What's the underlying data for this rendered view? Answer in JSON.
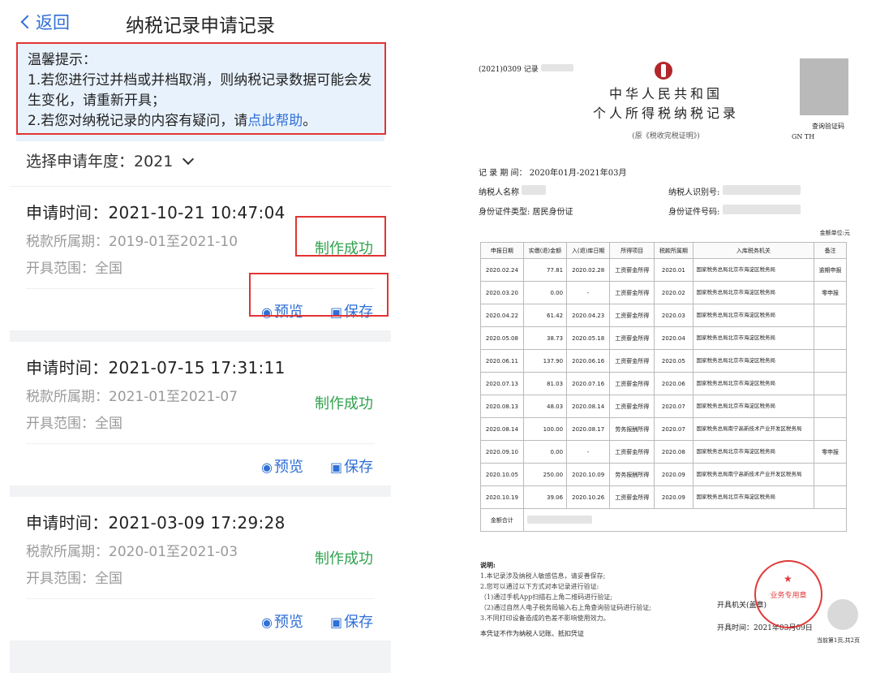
{
  "app": {
    "back_label": "返回",
    "title": "纳税记录申请记录",
    "tips": {
      "heading": "温馨提示：",
      "line1": "1.若您进行过并档或并档取消，则纳税记录数据可能会发生变化，请重新开具；",
      "line2_prefix": "2.若您对纳税记录的内容有疑问，请",
      "line2_link": "点此帮助",
      "line2_suffix": "。"
    },
    "year_label": "选择申请年度：2021",
    "records": [
      {
        "time": "申请时间：2021-10-21 10:47:04",
        "period": "税款所属期：2019-01至2021-10",
        "scope": "开具范围：全国",
        "status": "制作成功",
        "preview": "预览",
        "save": "保存"
      },
      {
        "time": "申请时间：2021-07-15 17:31:11",
        "period": "税款所属期：2021-01至2021-07",
        "scope": "开具范围：全国",
        "status": "制作成功",
        "preview": "预览",
        "save": "保存"
      },
      {
        "time": "申请时间：2021-03-09 17:29:28",
        "period": "税款所属期：2020-01至2021-03",
        "scope": "开具范围：全国",
        "status": "制作成功",
        "preview": "预览",
        "save": "保存"
      }
    ],
    "colors": {
      "accent": "#2f6fd6",
      "success": "#2fa24e",
      "highlight": "#e23434",
      "tip_bg": "#e8f2fd"
    }
  },
  "doc": {
    "number": "(2021)0309  记录",
    "title1": "中华人民共和国",
    "title2": "个人所得税纳税记录",
    "subtitle": "(原《税收完税证明》)",
    "qr_label": "查询验证码",
    "qr_code": "GN          TH",
    "period": "记 录 期 间： 2020年01月-2021年03月",
    "name_label": "纳税人名称",
    "taxid_label": "纳税人识别号:",
    "idtype_label": "身份证件类型:   居民身份证",
    "idno_label": "身份证件号码:",
    "unit": "金额单位:元",
    "headers": [
      "申报日期",
      "实缴(退)金额",
      "入(退)库日期",
      "所得项目",
      "税款所属期",
      "入库税务机关",
      "备注"
    ],
    "rows": [
      [
        "2020.02.24",
        "77.81",
        "2020.02.28",
        "工资薪金所得",
        "2020.01",
        "国家税务总局北京市海淀区税务局",
        "逾期申报"
      ],
      [
        "2020.03.20",
        "0.00",
        "-",
        "工资薪金所得",
        "2020.02",
        "国家税务总局北京市海淀区税务局",
        "零申报"
      ],
      [
        "2020.04.22",
        "61.42",
        "2020.04.23",
        "工资薪金所得",
        "2020.03",
        "国家税务总局北京市海淀区税务局",
        ""
      ],
      [
        "2020.05.08",
        "38.73",
        "2020.05.18",
        "工资薪金所得",
        "2020.04",
        "国家税务总局北京市海淀区税务局",
        ""
      ],
      [
        "2020.06.11",
        "137.90",
        "2020.06.16",
        "工资薪金所得",
        "2020.05",
        "国家税务总局北京市海淀区税务局",
        ""
      ],
      [
        "2020.07.13",
        "81.03",
        "2020.07.16",
        "工资薪金所得",
        "2020.06",
        "国家税务总局北京市海淀区税务局",
        ""
      ],
      [
        "2020.08.13",
        "48.03",
        "2020.08.14",
        "工资薪金所得",
        "2020.07",
        "国家税务总局北京市海淀区税务局",
        ""
      ],
      [
        "2020.08.14",
        "100.00",
        "2020.08.17",
        "劳务报酬所得",
        "2020.07",
        "国家税务总局南宁高新技术产业开发区税务局",
        ""
      ],
      [
        "2020.09.10",
        "0.00",
        "-",
        "工资薪金所得",
        "2020.08",
        "国家税务总局北京市海淀区税务局",
        "零申报"
      ],
      [
        "2020.10.05",
        "250.00",
        "2020.10.09",
        "劳务报酬所得",
        "2020.09",
        "国家税务总局南宁高新技术产业开发区税务局",
        ""
      ],
      [
        "2020.10.19",
        "39.06",
        "2020.10.26",
        "工资薪金所得",
        "2020.09",
        "国家税务总局北京市海淀区税务局",
        ""
      ]
    ],
    "total_label": "金额合计",
    "notes_heading": "说明:",
    "notes": [
      "1.本记录涉及纳税人敏感信息，请妥善保存;",
      "2.您可以通过以下方式对本记录进行验证:",
      "（1)通过手机App扫描右上角二维码进行验证;",
      "（2)通过自然人电子税务局输入右上角查询验证码进行验证;",
      "3.不同打印设备造成的色差不影响使用效力。"
    ],
    "footer_note": "本凭证不作为纳税人记账、抵扣凭证",
    "issuer": "开具机关(盖章)",
    "issue_time": "开具时间：2021年03月09日",
    "stamp_text": "业务专用章",
    "page": "当前第1页,共2页"
  }
}
